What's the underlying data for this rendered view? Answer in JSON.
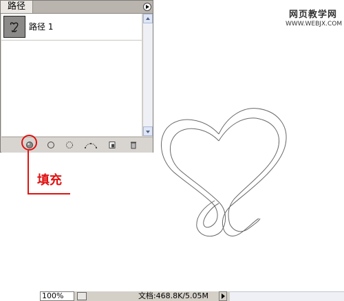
{
  "paths_panel": {
    "tab_label": "路径",
    "items": [
      {
        "label": "路径 1"
      }
    ],
    "tools": [
      "fill-path-icon",
      "stroke-path-icon",
      "load-selection-icon",
      "make-work-path-icon",
      "new-path-icon",
      "delete-path-icon"
    ]
  },
  "annotation": {
    "label": "填充",
    "color": "#e01010"
  },
  "watermark": {
    "title": "网页教学网",
    "url": "WWW.WEBJX.COM"
  },
  "statusbar": {
    "zoom": "100%",
    "doc_info": "文档:468.8K/5.05M"
  }
}
